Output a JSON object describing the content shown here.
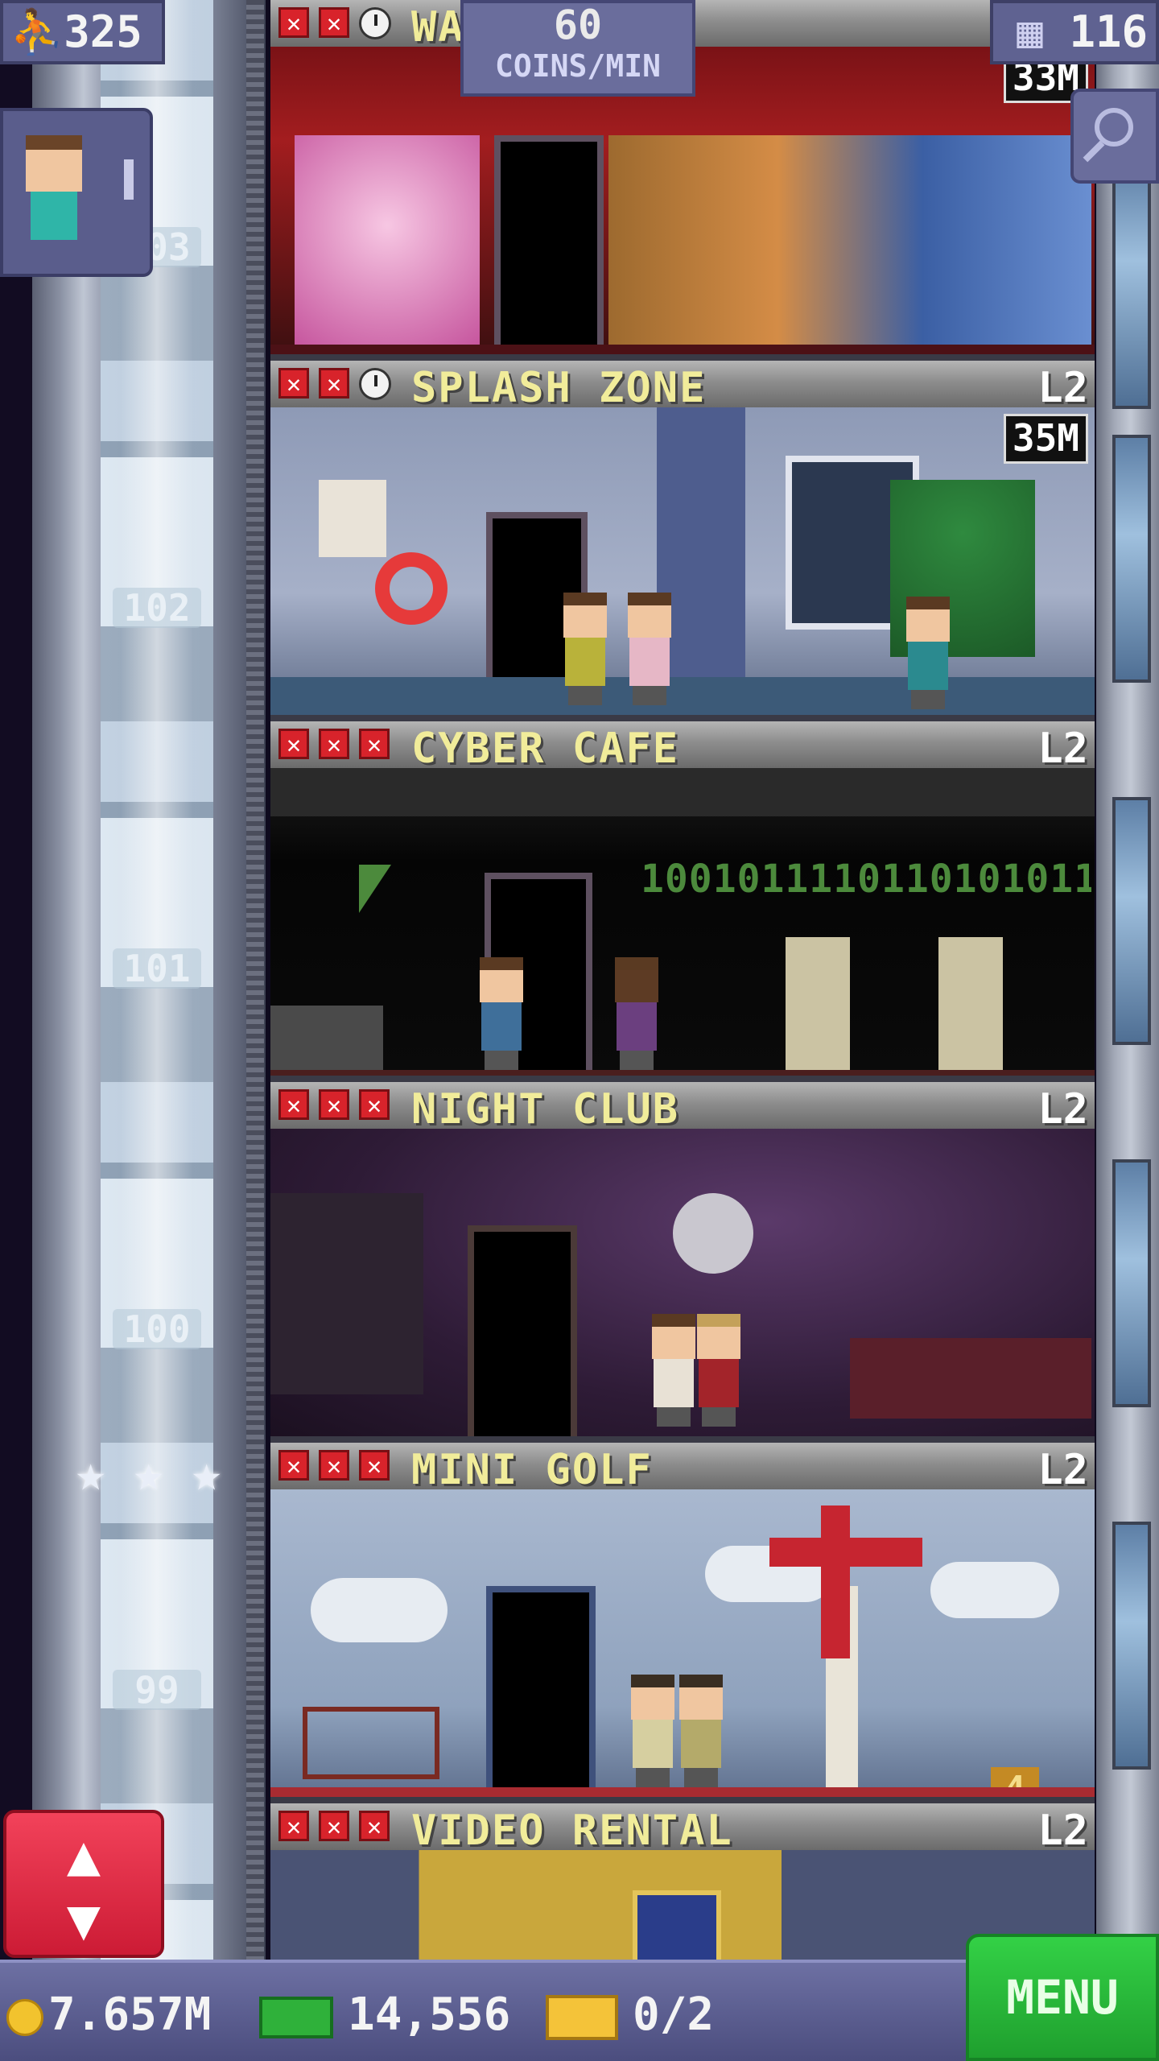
{
  "hud": {
    "population": "325",
    "floors_count": "116",
    "earn_rate_value": "60",
    "earn_rate_unit": "COINS/MIN"
  },
  "floors": [
    {
      "name": "WAX MUSEUM",
      "level": "",
      "price": "33M",
      "status": [
        "x",
        "x",
        "clock"
      ]
    },
    {
      "name": "SPLASH ZONE",
      "level": "L2",
      "price": "35M",
      "status": [
        "x",
        "x",
        "clock"
      ]
    },
    {
      "name": "CYBER CAFE",
      "level": "L2",
      "price": "",
      "status": [
        "x",
        "x",
        "x"
      ],
      "binary_text": "1001011110110101011"
    },
    {
      "name": "NIGHT CLUB",
      "level": "L2",
      "price": "",
      "status": [
        "x",
        "x",
        "x"
      ]
    },
    {
      "name": "MINI GOLF",
      "level": "L2",
      "price": "",
      "status": [
        "x",
        "x",
        "x"
      ],
      "hole_number": "4"
    },
    {
      "name": "VIDEO RENTAL",
      "level": "L2",
      "price": "",
      "status": [
        "x",
        "x",
        "x"
      ]
    }
  ],
  "elevator_floor_numbers": [
    "103",
    "102",
    "101",
    "100",
    "99"
  ],
  "elevator_stars": [
    "★",
    "★",
    "★"
  ],
  "bottom_bar": {
    "coins": "7.657M",
    "bux": "14,556",
    "tickets": "0/2",
    "menu_label": "MENU"
  },
  "colors": {
    "hud_panel": "#5f6291",
    "floor_title": "#f1ec9a",
    "status_x": "#d8232b",
    "menu_green": "#2fbd3e",
    "elevator_button": "#e8304a"
  },
  "icons": {
    "population": "person-icon",
    "floors": "building-icon",
    "zoom": "magnifier-icon",
    "coins": "coin-icon",
    "bux": "bux-icon",
    "tickets": "ticket-icon"
  }
}
